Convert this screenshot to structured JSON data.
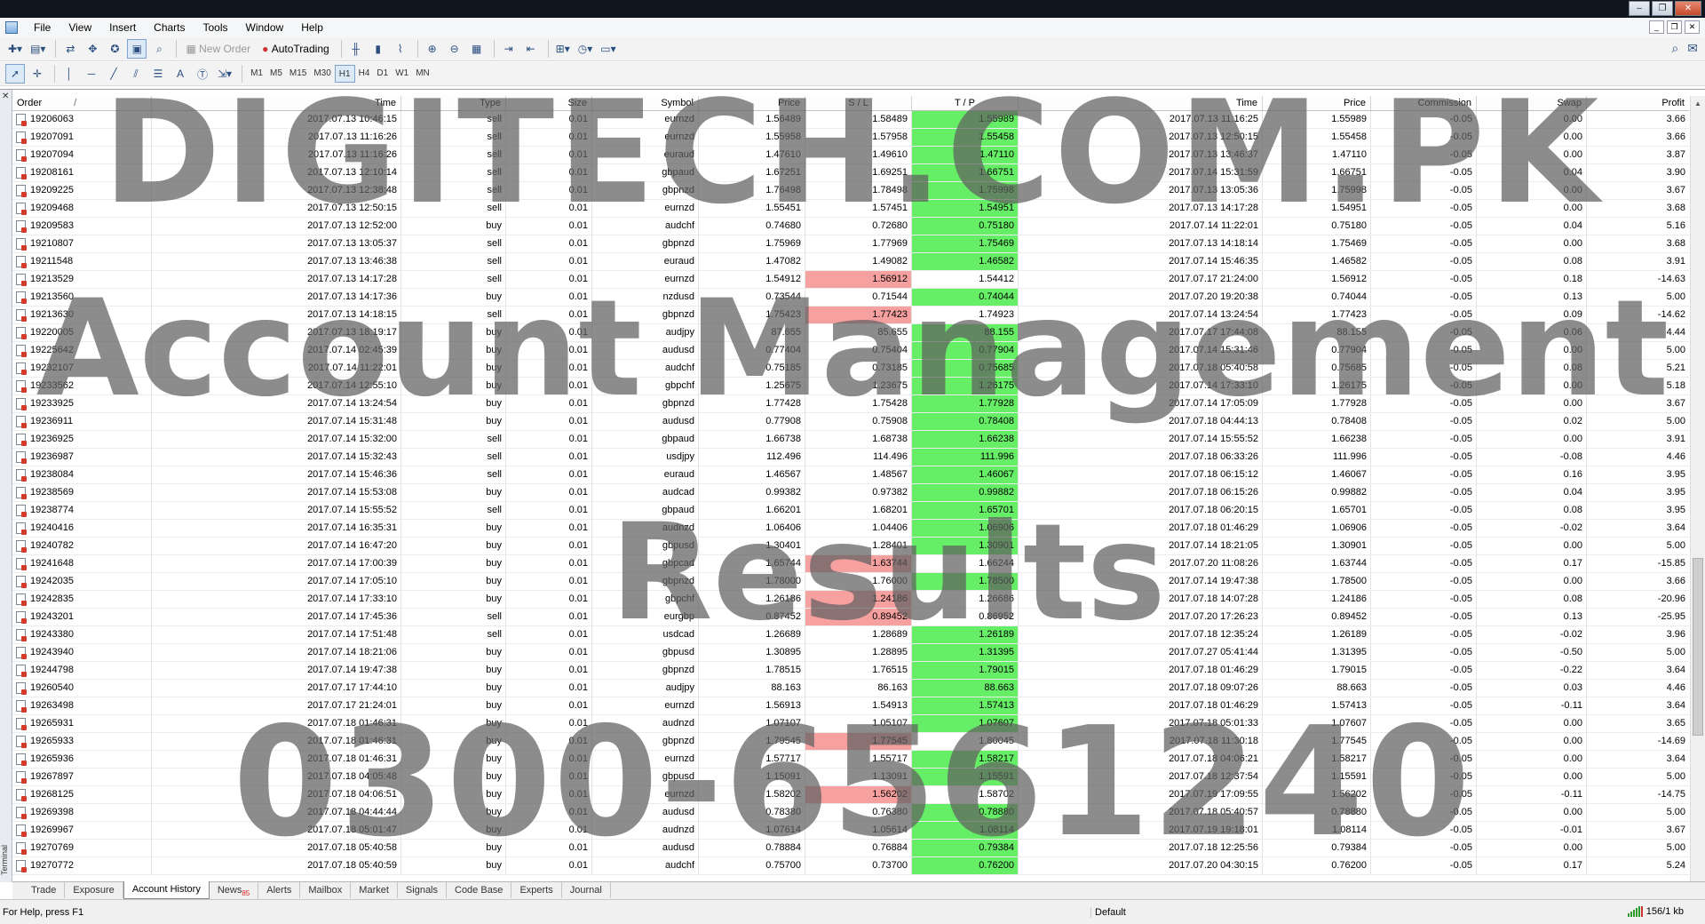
{
  "menu": [
    "File",
    "View",
    "Insert",
    "Charts",
    "Tools",
    "Window",
    "Help"
  ],
  "toolbar": {
    "new_order": "New Order",
    "autotrading": "AutoTrading"
  },
  "timeframes": [
    "M1",
    "M5",
    "M15",
    "M30",
    "H1",
    "H4",
    "D1",
    "W1",
    "MN"
  ],
  "columns": [
    "Order",
    "Time",
    "Type",
    "Size",
    "Symbol",
    "Price",
    "S / L",
    "T / P",
    "Time",
    "Price",
    "Commission",
    "Swap",
    "Profit"
  ],
  "rows": [
    {
      "order": "19206063",
      "time": "2017.07.13 10:46:15",
      "type": "sell",
      "size": "0.01",
      "symbol": "eurnzd",
      "price": "1.56489",
      "sl": "1.58489",
      "tp": "1.55989",
      "ctime": "2017.07.13 11:16:25",
      "cprice": "1.55989",
      "comm": "-0.05",
      "swap": "0.00",
      "profit": "3.66",
      "hit": "tp"
    },
    {
      "order": "19207091",
      "time": "2017.07.13 11:16:26",
      "type": "sell",
      "size": "0.01",
      "symbol": "eurnzd",
      "price": "1.55958",
      "sl": "1.57958",
      "tp": "1.55458",
      "ctime": "2017.07.13 12:50:15",
      "cprice": "1.55458",
      "comm": "-0.05",
      "swap": "0.00",
      "profit": "3.66",
      "hit": "tp"
    },
    {
      "order": "19207094",
      "time": "2017.07.13 11:16:26",
      "type": "sell",
      "size": "0.01",
      "symbol": "euraud",
      "price": "1.47610",
      "sl": "1.49610",
      "tp": "1.47110",
      "ctime": "2017.07.13 13:46:37",
      "cprice": "1.47110",
      "comm": "-0.05",
      "swap": "0.00",
      "profit": "3.87",
      "hit": "tp"
    },
    {
      "order": "19208161",
      "time": "2017.07.13 12:10:14",
      "type": "sell",
      "size": "0.01",
      "symbol": "gbpaud",
      "price": "1.67251",
      "sl": "1.69251",
      "tp": "1.66751",
      "ctime": "2017.07.14 15:31:59",
      "cprice": "1.66751",
      "comm": "-0.05",
      "swap": "0.04",
      "profit": "3.90",
      "hit": "tp"
    },
    {
      "order": "19209225",
      "time": "2017.07.13 12:38:48",
      "type": "sell",
      "size": "0.01",
      "symbol": "gbpnzd",
      "price": "1.76498",
      "sl": "1.78498",
      "tp": "1.75998",
      "ctime": "2017.07.13 13:05:36",
      "cprice": "1.75998",
      "comm": "-0.05",
      "swap": "0.00",
      "profit": "3.67",
      "hit": "tp"
    },
    {
      "order": "19209468",
      "time": "2017.07.13 12:50:15",
      "type": "sell",
      "size": "0.01",
      "symbol": "eurnzd",
      "price": "1.55451",
      "sl": "1.57451",
      "tp": "1.54951",
      "ctime": "2017.07.13 14:17:28",
      "cprice": "1.54951",
      "comm": "-0.05",
      "swap": "0.00",
      "profit": "3.68",
      "hit": "tp"
    },
    {
      "order": "19209583",
      "time": "2017.07.13 12:52:00",
      "type": "buy",
      "size": "0.01",
      "symbol": "audchf",
      "price": "0.74680",
      "sl": "0.72680",
      "tp": "0.75180",
      "ctime": "2017.07.14 11:22:01",
      "cprice": "0.75180",
      "comm": "-0.05",
      "swap": "0.04",
      "profit": "5.16",
      "hit": "tp"
    },
    {
      "order": "19210807",
      "time": "2017.07.13 13:05:37",
      "type": "sell",
      "size": "0.01",
      "symbol": "gbpnzd",
      "price": "1.75969",
      "sl": "1.77969",
      "tp": "1.75469",
      "ctime": "2017.07.13 14:18:14",
      "cprice": "1.75469",
      "comm": "-0.05",
      "swap": "0.00",
      "profit": "3.68",
      "hit": "tp"
    },
    {
      "order": "19211548",
      "time": "2017.07.13 13:46:38",
      "type": "sell",
      "size": "0.01",
      "symbol": "euraud",
      "price": "1.47082",
      "sl": "1.49082",
      "tp": "1.46582",
      "ctime": "2017.07.14 15:46:35",
      "cprice": "1.46582",
      "comm": "-0.05",
      "swap": "0.08",
      "profit": "3.91",
      "hit": "tp"
    },
    {
      "order": "19213529",
      "time": "2017.07.13 14:17:28",
      "type": "sell",
      "size": "0.01",
      "symbol": "eurnzd",
      "price": "1.54912",
      "sl": "1.56912",
      "tp": "1.54412",
      "ctime": "2017.07.17 21:24:00",
      "cprice": "1.56912",
      "comm": "-0.05",
      "swap": "0.18",
      "profit": "-14.63",
      "hit": "sl"
    },
    {
      "order": "19213560",
      "time": "2017.07.13 14:17:36",
      "type": "buy",
      "size": "0.01",
      "symbol": "nzdusd",
      "price": "0.73544",
      "sl": "0.71544",
      "tp": "0.74044",
      "ctime": "2017.07.20 19:20:38",
      "cprice": "0.74044",
      "comm": "-0.05",
      "swap": "0.13",
      "profit": "5.00",
      "hit": "tp"
    },
    {
      "order": "19213630",
      "time": "2017.07.13 14:18:15",
      "type": "sell",
      "size": "0.01",
      "symbol": "gbpnzd",
      "price": "1.75423",
      "sl": "1.77423",
      "tp": "1.74923",
      "ctime": "2017.07.14 13:24:54",
      "cprice": "1.77423",
      "comm": "-0.05",
      "swap": "0.09",
      "profit": "-14.62",
      "hit": "sl"
    },
    {
      "order": "19220005",
      "time": "2017.07.13 18:19:17",
      "type": "buy",
      "size": "0.01",
      "symbol": "audjpy",
      "price": "87.655",
      "sl": "85.655",
      "tp": "88.155",
      "ctime": "2017.07.17 17:44:08",
      "cprice": "88.155",
      "comm": "-0.05",
      "swap": "0.06",
      "profit": "4.44",
      "hit": "tp"
    },
    {
      "order": "19225642",
      "time": "2017.07.14 02:45:39",
      "type": "buy",
      "size": "0.01",
      "symbol": "audusd",
      "price": "0.77404",
      "sl": "0.75404",
      "tp": "0.77904",
      "ctime": "2017.07.14 15:31:46",
      "cprice": "0.77904",
      "comm": "-0.05",
      "swap": "0.00",
      "profit": "5.00",
      "hit": "tp"
    },
    {
      "order": "19232107",
      "time": "2017.07.14 11:22:01",
      "type": "buy",
      "size": "0.01",
      "symbol": "audchf",
      "price": "0.75185",
      "sl": "0.73185",
      "tp": "0.75685",
      "ctime": "2017.07.18 05:40:58",
      "cprice": "0.75685",
      "comm": "-0.05",
      "swap": "0.08",
      "profit": "5.21",
      "hit": "tp"
    },
    {
      "order": "19233562",
      "time": "2017.07.14 12:55:10",
      "type": "buy",
      "size": "0.01",
      "symbol": "gbpchf",
      "price": "1.25675",
      "sl": "1.23675",
      "tp": "1.26175",
      "ctime": "2017.07.14 17:33:10",
      "cprice": "1.26175",
      "comm": "-0.05",
      "swap": "0.00",
      "profit": "5.18",
      "hit": "tp"
    },
    {
      "order": "19233925",
      "time": "2017.07.14 13:24:54",
      "type": "buy",
      "size": "0.01",
      "symbol": "gbpnzd",
      "price": "1.77428",
      "sl": "1.75428",
      "tp": "1.77928",
      "ctime": "2017.07.14 17:05:09",
      "cprice": "1.77928",
      "comm": "-0.05",
      "swap": "0.00",
      "profit": "3.67",
      "hit": "tp"
    },
    {
      "order": "19236911",
      "time": "2017.07.14 15:31:48",
      "type": "buy",
      "size": "0.01",
      "symbol": "audusd",
      "price": "0.77908",
      "sl": "0.75908",
      "tp": "0.78408",
      "ctime": "2017.07.18 04:44:13",
      "cprice": "0.78408",
      "comm": "-0.05",
      "swap": "0.02",
      "profit": "5.00",
      "hit": "tp"
    },
    {
      "order": "19236925",
      "time": "2017.07.14 15:32:00",
      "type": "sell",
      "size": "0.01",
      "symbol": "gbpaud",
      "price": "1.66738",
      "sl": "1.68738",
      "tp": "1.66238",
      "ctime": "2017.07.14 15:55:52",
      "cprice": "1.66238",
      "comm": "-0.05",
      "swap": "0.00",
      "profit": "3.91",
      "hit": "tp"
    },
    {
      "order": "19236987",
      "time": "2017.07.14 15:32:43",
      "type": "sell",
      "size": "0.01",
      "symbol": "usdjpy",
      "price": "112.496",
      "sl": "114.496",
      "tp": "111.996",
      "ctime": "2017.07.18 06:33:26",
      "cprice": "111.996",
      "comm": "-0.05",
      "swap": "-0.08",
      "profit": "4.46",
      "hit": "tp"
    },
    {
      "order": "19238084",
      "time": "2017.07.14 15:46:36",
      "type": "sell",
      "size": "0.01",
      "symbol": "euraud",
      "price": "1.46567",
      "sl": "1.48567",
      "tp": "1.46067",
      "ctime": "2017.07.18 06:15:12",
      "cprice": "1.46067",
      "comm": "-0.05",
      "swap": "0.16",
      "profit": "3.95",
      "hit": "tp"
    },
    {
      "order": "19238569",
      "time": "2017.07.14 15:53:08",
      "type": "buy",
      "size": "0.01",
      "symbol": "audcad",
      "price": "0.99382",
      "sl": "0.97382",
      "tp": "0.99882",
      "ctime": "2017.07.18 06:15:26",
      "cprice": "0.99882",
      "comm": "-0.05",
      "swap": "0.04",
      "profit": "3.95",
      "hit": "tp"
    },
    {
      "order": "19238774",
      "time": "2017.07.14 15:55:52",
      "type": "sell",
      "size": "0.01",
      "symbol": "gbpaud",
      "price": "1.66201",
      "sl": "1.68201",
      "tp": "1.65701",
      "ctime": "2017.07.18 06:20:15",
      "cprice": "1.65701",
      "comm": "-0.05",
      "swap": "0.08",
      "profit": "3.95",
      "hit": "tp"
    },
    {
      "order": "19240416",
      "time": "2017.07.14 16:35:31",
      "type": "buy",
      "size": "0.01",
      "symbol": "audnzd",
      "price": "1.06406",
      "sl": "1.04406",
      "tp": "1.06906",
      "ctime": "2017.07.18 01:46:29",
      "cprice": "1.06906",
      "comm": "-0.05",
      "swap": "-0.02",
      "profit": "3.64",
      "hit": "tp"
    },
    {
      "order": "19240782",
      "time": "2017.07.14 16:47:20",
      "type": "buy",
      "size": "0.01",
      "symbol": "gbpusd",
      "price": "1.30401",
      "sl": "1.28401",
      "tp": "1.30901",
      "ctime": "2017.07.14 18:21:05",
      "cprice": "1.30901",
      "comm": "-0.05",
      "swap": "0.00",
      "profit": "5.00",
      "hit": "tp"
    },
    {
      "order": "19241648",
      "time": "2017.07.14 17:00:39",
      "type": "buy",
      "size": "0.01",
      "symbol": "gbpcad",
      "price": "1.65744",
      "sl": "1.63744",
      "tp": "1.66244",
      "ctime": "2017.07.20 11:08:26",
      "cprice": "1.63744",
      "comm": "-0.05",
      "swap": "0.17",
      "profit": "-15.85",
      "hit": "sl"
    },
    {
      "order": "19242035",
      "time": "2017.07.14 17:05:10",
      "type": "buy",
      "size": "0.01",
      "symbol": "gbpnzd",
      "price": "1.78000",
      "sl": "1.76000",
      "tp": "1.78500",
      "ctime": "2017.07.14 19:47:38",
      "cprice": "1.78500",
      "comm": "-0.05",
      "swap": "0.00",
      "profit": "3.66",
      "hit": "tp"
    },
    {
      "order": "19242835",
      "time": "2017.07.14 17:33:10",
      "type": "buy",
      "size": "0.01",
      "symbol": "gbpchf",
      "price": "1.26186",
      "sl": "1.24186",
      "tp": "1.26686",
      "ctime": "2017.07.18 14:07:28",
      "cprice": "1.24186",
      "comm": "-0.05",
      "swap": "0.08",
      "profit": "-20.96",
      "hit": "sl"
    },
    {
      "order": "19243201",
      "time": "2017.07.14 17:45:36",
      "type": "sell",
      "size": "0.01",
      "symbol": "eurgbp",
      "price": "0.87452",
      "sl": "0.89452",
      "tp": "0.86952",
      "ctime": "2017.07.20 17:26:23",
      "cprice": "0.89452",
      "comm": "-0.05",
      "swap": "0.13",
      "profit": "-25.95",
      "hit": "sl"
    },
    {
      "order": "19243380",
      "time": "2017.07.14 17:51:48",
      "type": "sell",
      "size": "0.01",
      "symbol": "usdcad",
      "price": "1.26689",
      "sl": "1.28689",
      "tp": "1.26189",
      "ctime": "2017.07.18 12:35:24",
      "cprice": "1.26189",
      "comm": "-0.05",
      "swap": "-0.02",
      "profit": "3.96",
      "hit": "tp"
    },
    {
      "order": "19243940",
      "time": "2017.07.14 18:21:06",
      "type": "buy",
      "size": "0.01",
      "symbol": "gbpusd",
      "price": "1.30895",
      "sl": "1.28895",
      "tp": "1.31395",
      "ctime": "2017.07.27 05:41:44",
      "cprice": "1.31395",
      "comm": "-0.05",
      "swap": "-0.50",
      "profit": "5.00",
      "hit": "tp"
    },
    {
      "order": "19244798",
      "time": "2017.07.14 19:47:38",
      "type": "buy",
      "size": "0.01",
      "symbol": "gbpnzd",
      "price": "1.78515",
      "sl": "1.76515",
      "tp": "1.79015",
      "ctime": "2017.07.18 01:46:29",
      "cprice": "1.79015",
      "comm": "-0.05",
      "swap": "-0.22",
      "profit": "3.64",
      "hit": "tp"
    },
    {
      "order": "19260540",
      "time": "2017.07.17 17:44:10",
      "type": "buy",
      "size": "0.01",
      "symbol": "audjpy",
      "price": "88.163",
      "sl": "86.163",
      "tp": "88.663",
      "ctime": "2017.07.18 09:07:26",
      "cprice": "88.663",
      "comm": "-0.05",
      "swap": "0.03",
      "profit": "4.46",
      "hit": "tp"
    },
    {
      "order": "19263498",
      "time": "2017.07.17 21:24:01",
      "type": "buy",
      "size": "0.01",
      "symbol": "eurnzd",
      "price": "1.56913",
      "sl": "1.54913",
      "tp": "1.57413",
      "ctime": "2017.07.18 01:46:29",
      "cprice": "1.57413",
      "comm": "-0.05",
      "swap": "-0.11",
      "profit": "3.64",
      "hit": "tp"
    },
    {
      "order": "19265931",
      "time": "2017.07.18 01:46:31",
      "type": "buy",
      "size": "0.01",
      "symbol": "audnzd",
      "price": "1.07107",
      "sl": "1.05107",
      "tp": "1.07607",
      "ctime": "2017.07.18 05:01:33",
      "cprice": "1.07607",
      "comm": "-0.05",
      "swap": "0.00",
      "profit": "3.65",
      "hit": "tp"
    },
    {
      "order": "19265933",
      "time": "2017.07.18 01:46:31",
      "type": "buy",
      "size": "0.01",
      "symbol": "gbpnzd",
      "price": "1.79545",
      "sl": "1.77545",
      "tp": "1.80045",
      "ctime": "2017.07.18 11:30:18",
      "cprice": "1.77545",
      "comm": "-0.05",
      "swap": "0.00",
      "profit": "-14.69",
      "hit": "sl"
    },
    {
      "order": "19265936",
      "time": "2017.07.18 01:46:31",
      "type": "buy",
      "size": "0.01",
      "symbol": "eurnzd",
      "price": "1.57717",
      "sl": "1.55717",
      "tp": "1.58217",
      "ctime": "2017.07.18 04:06:21",
      "cprice": "1.58217",
      "comm": "-0.05",
      "swap": "0.00",
      "profit": "3.64",
      "hit": "tp"
    },
    {
      "order": "19267897",
      "time": "2017.07.18 04:05:48",
      "type": "buy",
      "size": "0.01",
      "symbol": "gbpusd",
      "price": "1.15091",
      "sl": "1.13091",
      "tp": "1.15591",
      "ctime": "2017.07.18 12:37:54",
      "cprice": "1.15591",
      "comm": "-0.05",
      "swap": "0.00",
      "profit": "5.00",
      "hit": "tp"
    },
    {
      "order": "19268125",
      "time": "2017.07.18 04:06:51",
      "type": "buy",
      "size": "0.01",
      "symbol": "eurnzd",
      "price": "1.58202",
      "sl": "1.56202",
      "tp": "1.58702",
      "ctime": "2017.07.19 17:09:55",
      "cprice": "1.56202",
      "comm": "-0.05",
      "swap": "-0.11",
      "profit": "-14.75",
      "hit": "sl"
    },
    {
      "order": "19269398",
      "time": "2017.07.18 04:44:44",
      "type": "buy",
      "size": "0.01",
      "symbol": "audusd",
      "price": "0.78380",
      "sl": "0.76380",
      "tp": "0.78880",
      "ctime": "2017.07.18 05:40:57",
      "cprice": "0.78880",
      "comm": "-0.05",
      "swap": "0.00",
      "profit": "5.00",
      "hit": "tp"
    },
    {
      "order": "19269967",
      "time": "2017.07.18 05:01:47",
      "type": "buy",
      "size": "0.01",
      "symbol": "audnzd",
      "price": "1.07614",
      "sl": "1.05614",
      "tp": "1.08114",
      "ctime": "2017.07.19 19:18:01",
      "cprice": "1.08114",
      "comm": "-0.05",
      "swap": "-0.01",
      "profit": "3.67",
      "hit": "tp"
    },
    {
      "order": "19270769",
      "time": "2017.07.18 05:40:58",
      "type": "buy",
      "size": "0.01",
      "symbol": "audusd",
      "price": "0.78884",
      "sl": "0.76884",
      "tp": "0.79384",
      "ctime": "2017.07.18 12:25:56",
      "cprice": "0.79384",
      "comm": "-0.05",
      "swap": "0.00",
      "profit": "5.00",
      "hit": "tp"
    },
    {
      "order": "19270772",
      "time": "2017.07.18 05:40:59",
      "type": "buy",
      "size": "0.01",
      "symbol": "audchf",
      "price": "0.75700",
      "sl": "0.73700",
      "tp": "0.76200",
      "ctime": "2017.07.20 04:30:15",
      "cprice": "0.76200",
      "comm": "-0.05",
      "swap": "0.17",
      "profit": "5.24",
      "hit": "tp"
    }
  ],
  "watermark": [
    "DIGITECH.COM.PK",
    "Account Management",
    "Results",
    "0300-6561240"
  ],
  "terminal_label": "Terminal",
  "tabs": [
    "Trade",
    "Exposure",
    "Account History",
    "News",
    "Alerts",
    "Mailbox",
    "Market",
    "Signals",
    "Code Base",
    "Experts",
    "Journal"
  ],
  "active_tab": "Account History",
  "news_count": "85",
  "status": {
    "help": "For Help, press F1",
    "profile": "Default",
    "traffic": "156/1 kb"
  },
  "colors": {
    "sl_hit": "#f7a0a0",
    "tp_hit": "#66ee66"
  }
}
